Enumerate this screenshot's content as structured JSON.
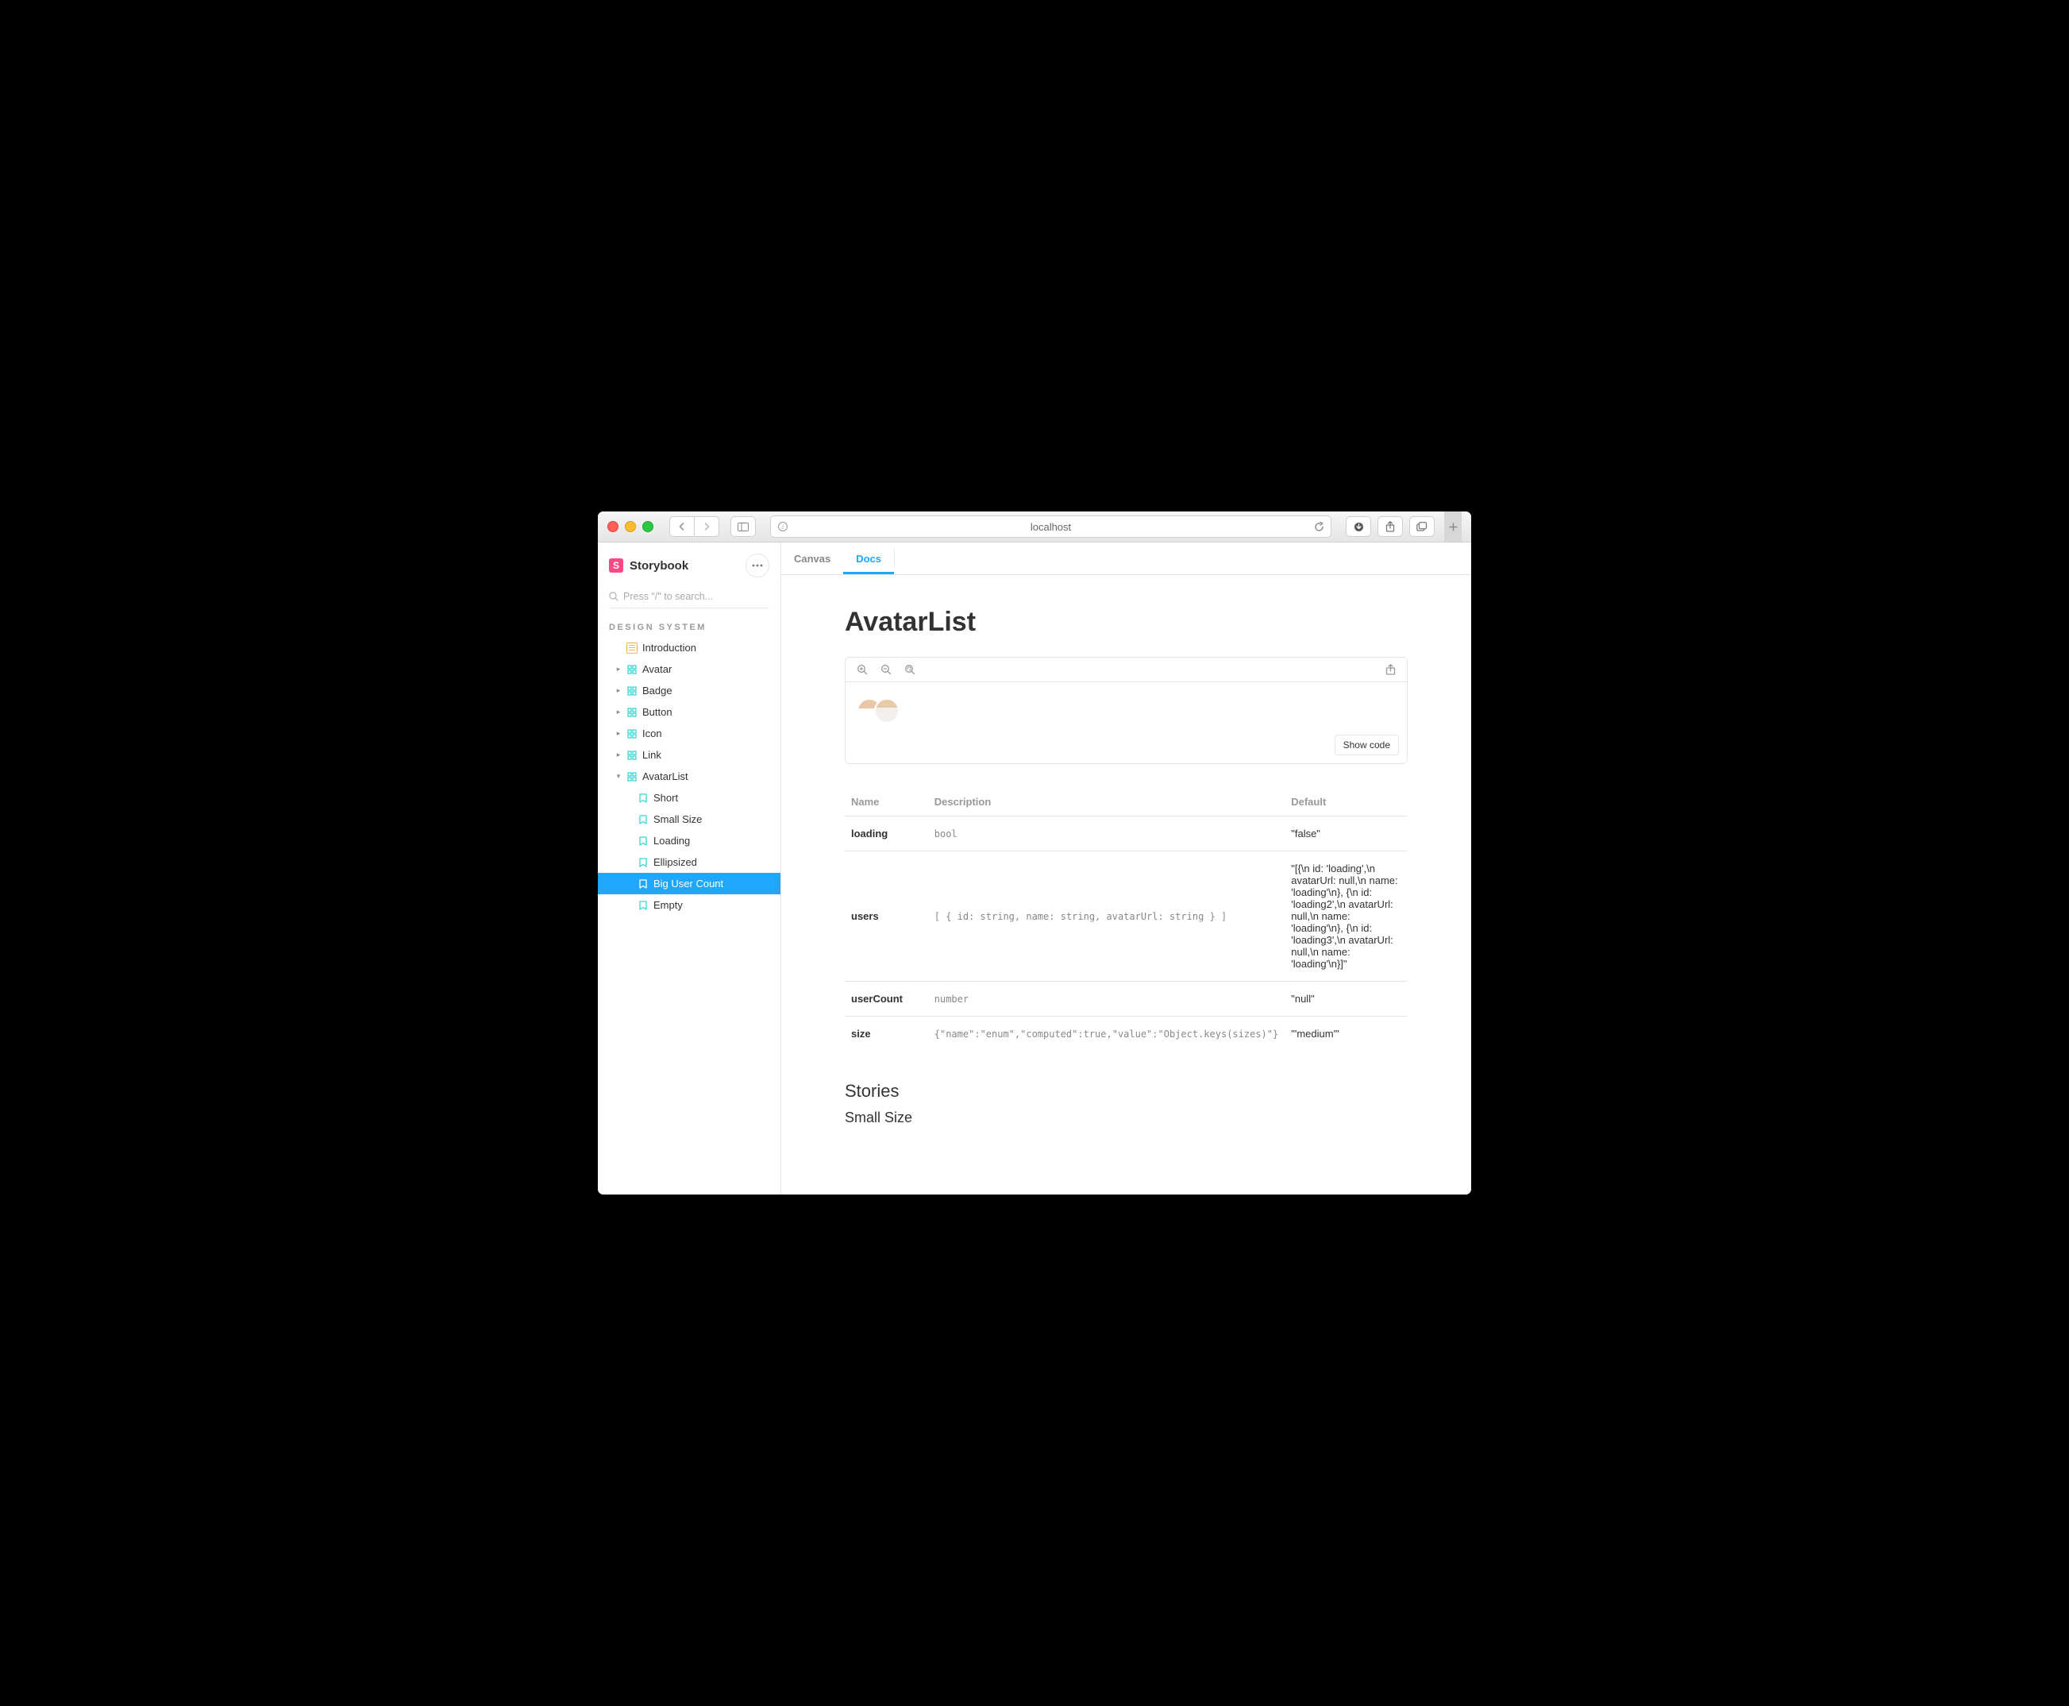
{
  "browser": {
    "address": "localhost"
  },
  "brand": {
    "name": "Storybook",
    "logo_letter": "S"
  },
  "search": {
    "placeholder": "Press \"/\" to search..."
  },
  "sidebar": {
    "section_title": "DESIGN SYSTEM",
    "items": [
      {
        "type": "doc",
        "label": "Introduction"
      },
      {
        "type": "component",
        "label": "Avatar",
        "children": false
      },
      {
        "type": "component",
        "label": "Badge",
        "children": false
      },
      {
        "type": "component",
        "label": "Button",
        "children": false
      },
      {
        "type": "component",
        "label": "Icon",
        "children": false
      },
      {
        "type": "component",
        "label": "Link",
        "children": false
      },
      {
        "type": "component",
        "label": "AvatarList",
        "expanded": true,
        "children": [
          {
            "label": "Short"
          },
          {
            "label": "Small Size"
          },
          {
            "label": "Loading"
          },
          {
            "label": "Ellipsized"
          },
          {
            "label": "Big User Count",
            "selected": true
          },
          {
            "label": "Empty"
          }
        ]
      }
    ]
  },
  "tabs": [
    {
      "label": "Canvas",
      "active": false
    },
    {
      "label": "Docs",
      "active": true
    }
  ],
  "doc": {
    "title": "AvatarList",
    "show_code_label": "Show code",
    "props_headers": {
      "name": "Name",
      "description": "Description",
      "default": "Default"
    },
    "props": [
      {
        "name": "loading",
        "description": "bool",
        "default": "\"false\""
      },
      {
        "name": "users",
        "description": "[ { id: string, name: string, avatarUrl: string } ]",
        "default": "\"[{\\n id: 'loading',\\n avatarUrl: null,\\n name: 'loading'\\n}, {\\n id: 'loading2',\\n avatarUrl: null,\\n name: 'loading'\\n}, {\\n id: 'loading3',\\n avatarUrl: null,\\n name: 'loading'\\n}]\""
      },
      {
        "name": "userCount",
        "description": "number",
        "default": "\"null\""
      },
      {
        "name": "size",
        "description": "{\"name\":\"enum\",\"computed\":true,\"value\":\"Object.keys(sizes)\"}",
        "default": "\"'medium'\""
      }
    ],
    "stories_heading": "Stories",
    "first_story": "Small Size"
  }
}
